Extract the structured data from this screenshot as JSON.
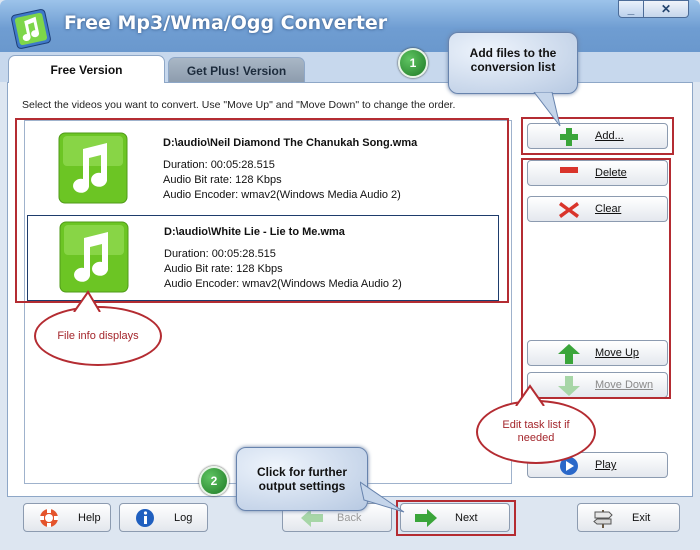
{
  "window": {
    "title": "Free Mp3/Wma/Ogg Converter",
    "controls": {
      "minimize": "_",
      "close": "✕"
    }
  },
  "tabs": [
    {
      "label": "Free Version",
      "active": true
    },
    {
      "label": "Get Plus! Version",
      "active": false
    }
  ],
  "instruction": "Select the videos you want to convert. Use \"Move Up\" and \"Move Down\" to change the order.",
  "files": [
    {
      "name": "D:\\audio\\Neil Diamond  The Chanukah Song.wma",
      "duration": "Duration: 00:05:28.515",
      "bitrate": "Audio Bit rate: 128 Kbps",
      "encoder": "Audio Encoder: wmav2(Windows Media Audio 2)",
      "selected": false
    },
    {
      "name": "D:\\audio\\White Lie - Lie to Me.wma",
      "duration": "Duration: 00:05:28.515",
      "bitrate": "Audio Bit rate: 128 Kbps",
      "encoder": "Audio Encoder: wmav2(Windows Media Audio 2)",
      "selected": true
    }
  ],
  "side_buttons": {
    "add": "Add...",
    "delete": "Delete",
    "clear": "Clear",
    "move_up": "Move Up",
    "move_down": "Move Down",
    "play": "Play"
  },
  "bottom_buttons": {
    "help": "Help",
    "log": "Log",
    "back": "Back",
    "next": "Next",
    "exit": "Exit"
  },
  "annotations": {
    "step1_number": "1",
    "step1_text": "Add files to the conversion list",
    "step2_number": "2",
    "step2_text": "Click for further output settings",
    "file_info_note": "File info displays",
    "edit_task_note": "Edit task list if needed"
  },
  "colors": {
    "highlight_red": "#b42c32",
    "selection_border": "#1e3c6c",
    "music_green": "#6cc524",
    "title_blue": "#6f9dd2"
  }
}
